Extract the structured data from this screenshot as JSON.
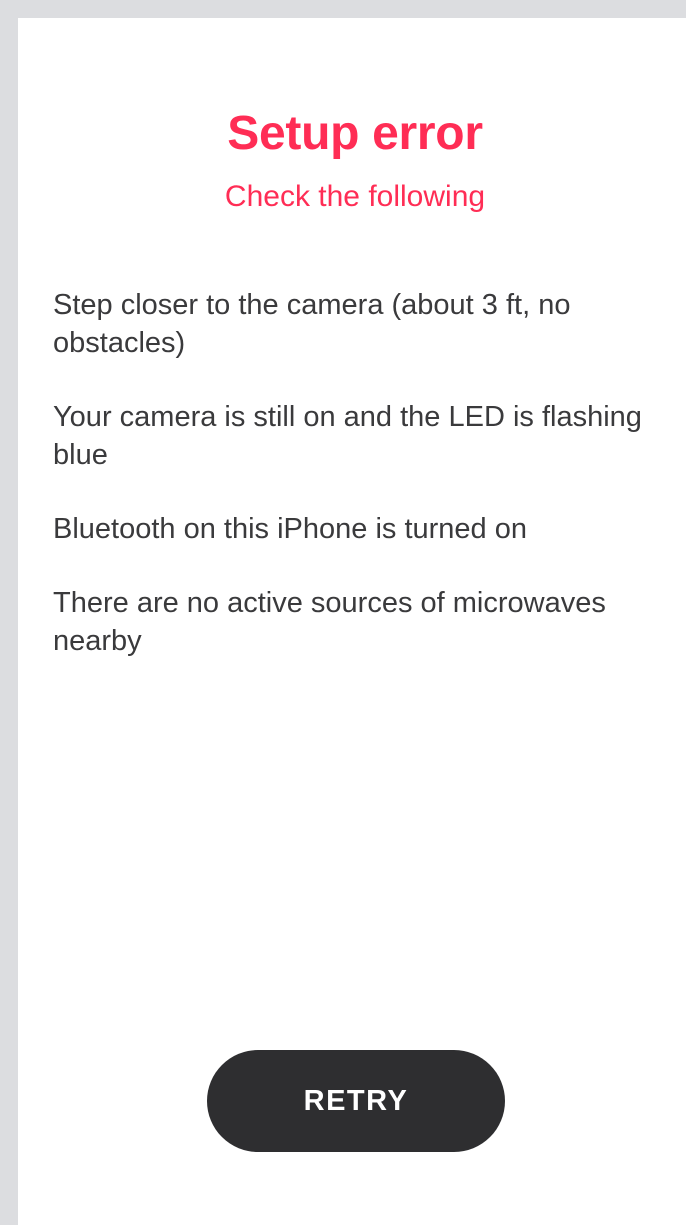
{
  "colors": {
    "error": "#ff2d55",
    "text": "#3a3a3c",
    "button_bg": "#2e2e30",
    "button_text": "#ffffff",
    "frame_bg": "#dcdde0",
    "screen_bg": "#ffffff"
  },
  "header": {
    "title": "Setup error",
    "subtitle": "Check the following"
  },
  "checklist": {
    "items": [
      "Step closer to the camera (about 3 ft, no obstacles)",
      "Your camera is still on and the LED is flashing blue",
      "Bluetooth on this iPhone is turned on",
      "There are no active sources of microwaves nearby"
    ]
  },
  "actions": {
    "retry_label": "RETRY"
  }
}
